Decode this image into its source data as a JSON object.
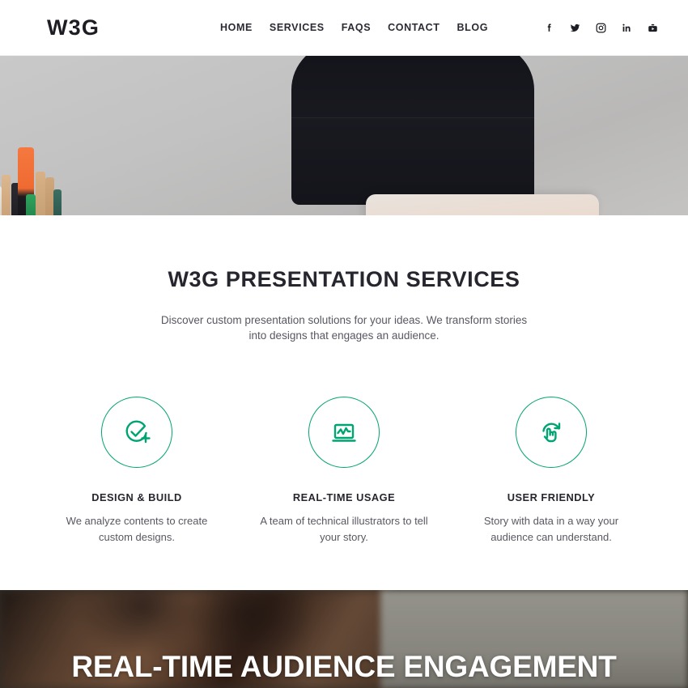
{
  "header": {
    "logo": "W3G",
    "nav": [
      {
        "label": "HOME",
        "name": "nav-home"
      },
      {
        "label": "SERVICES",
        "name": "nav-services"
      },
      {
        "label": "FAQS",
        "name": "nav-faqs"
      },
      {
        "label": "CONTACT",
        "name": "nav-contact"
      },
      {
        "label": "BLOG",
        "name": "nav-blog"
      }
    ],
    "social": [
      {
        "icon": "facebook-icon"
      },
      {
        "icon": "twitter-icon"
      },
      {
        "icon": "instagram-icon"
      },
      {
        "icon": "linkedin-icon"
      },
      {
        "icon": "youtube-icon"
      }
    ]
  },
  "hero": {
    "image_description": "Office desk photo: gray wall, black chair back, silver MacBook lid with Apple logo, cup of pencils and markers at left"
  },
  "services": {
    "title": "W3G PRESENTATION SERVICES",
    "subtitle": "Discover custom presentation solutions for your ideas. We transform stories into designs that engages an audience.",
    "accent_color": "#00a472",
    "features": [
      {
        "icon": "check-circle-plus-icon",
        "title": "DESIGN & BUILD",
        "text": "We analyze contents to create custom designs."
      },
      {
        "icon": "laptop-chart-icon",
        "title": "REAL-TIME USAGE",
        "text": "A team of technical illustrators to tell your story."
      },
      {
        "icon": "hand-refresh-icon",
        "title": "USER FRIENDLY",
        "text": "Story with data in a way your audience can understand."
      }
    ]
  },
  "banner": {
    "title": "REAL-TIME AUDIENCE ENGAGEMENT",
    "image_description": "Blurred photo of a person in front of a screen displaying colorful content"
  }
}
